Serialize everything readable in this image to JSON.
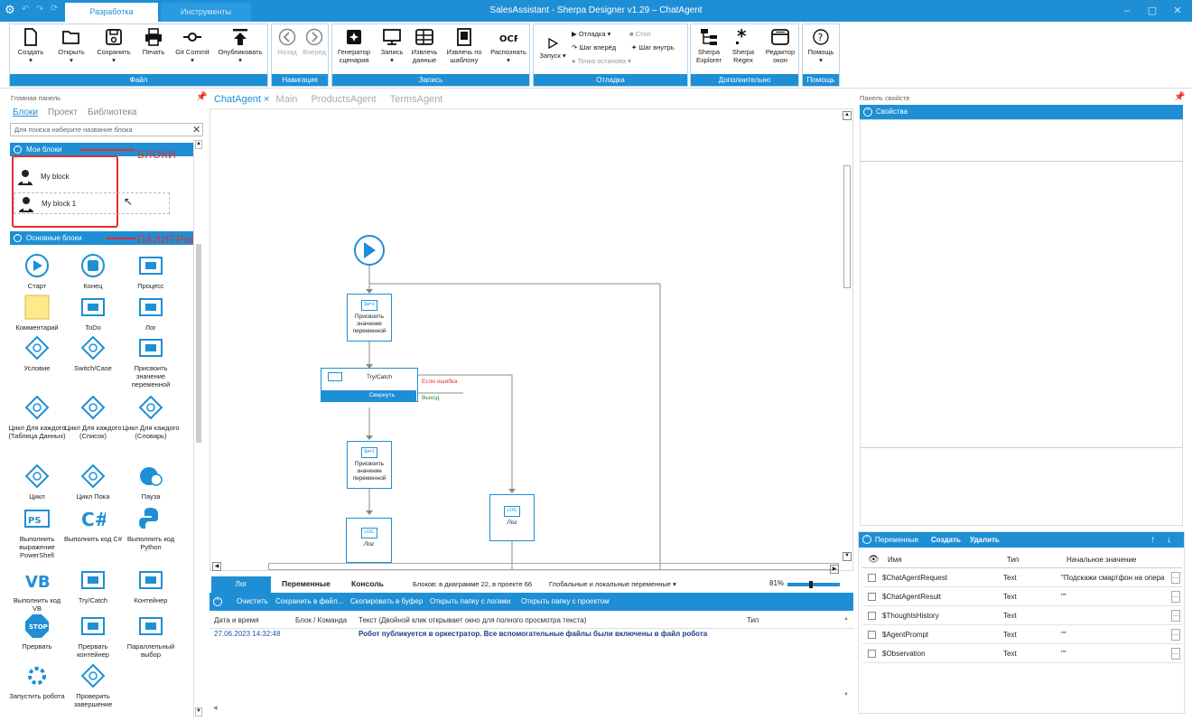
{
  "titlebar": {
    "title": "SalesAssistant - Sherpa Designer v1.29 – ChatAgent",
    "tabs": [
      "Разработка",
      "Инструменты"
    ]
  },
  "ribbon": {
    "file": {
      "label": "Файл",
      "buttons": [
        "Создать",
        "Открыть",
        "Сохранить",
        "Печать",
        "Git Commit",
        "Опубликовать"
      ]
    },
    "navigation": {
      "label": "Навигация",
      "buttons": [
        "Назад",
        "Вперед"
      ]
    },
    "record": {
      "label": "Запись",
      "buttons": [
        "Генератор сценария",
        "Запись",
        "Извлечь данные",
        "Извлечь по шаблону",
        "Распознать"
      ]
    },
    "debug": {
      "label": "Отладка",
      "run": "Запуск",
      "debug": "Отладка",
      "stop": "Стоп",
      "step_forward": "Шаг вперёд",
      "step_into": "Шаг внутрь",
      "breakpoint": "Точка останова"
    },
    "extra": {
      "label": "Дополнительно",
      "buttons": [
        "Sherpa Explorer",
        "Sherpa Regex",
        "Редактор окон"
      ]
    },
    "help": {
      "label": "Помощь",
      "buttons": [
        "Помощь"
      ]
    }
  },
  "left": {
    "panel_title": "Главная панель",
    "tabs": [
      "Блоки",
      "Проект",
      "Библиотека"
    ],
    "search_placeholder": "Для поиска наберите название блока",
    "my_blocks_header": "Мои блоки",
    "my_blocks": [
      "My block",
      "My block 1"
    ],
    "basic_blocks_header": "Основные блоки",
    "annot_blocks": "БЛОКИ",
    "annot_palettes": "ПАЛИТРЫ",
    "palette": [
      "Старт",
      "Конец",
      "Процесс",
      "Комментарий",
      "ToDo",
      "Лог",
      "Условие",
      "Switch/Case",
      "Присвоить значение переменной",
      "Цикл Для каждого (Таблица Данных)",
      "Цикл Для каждого (Список)",
      "Цикл Для каждого (Словарь)",
      "Цикл",
      "Цикл Пока",
      "Пауза",
      "Выполнить выражение PowerShell",
      "Выполнить код C#",
      "Выполнить код Python",
      "Выполнить код VB",
      "Try/Catch",
      "Контейнер",
      "Прервать",
      "Прервать контейнер",
      "Параллельный выбор",
      "Запустить робота",
      "Проверить завершение"
    ]
  },
  "center": {
    "doc_tabs": [
      "ChatAgent",
      "Main",
      "ProductsAgent",
      "TermsAgent"
    ],
    "nodes": {
      "assign1": "Присвоить значение переменной",
      "trycatch": "Try/Catch",
      "collapse": "Свернуть",
      "on_error": "Если ошибка",
      "exit": "Выход",
      "assign2": "Присвоить значение переменной",
      "log1": "Лог",
      "log2": "Лог"
    }
  },
  "log": {
    "tabs": [
      "Лог",
      "Переменные",
      "Консоль"
    ],
    "blocks_info": "Блоков: в диаграмме 22, в проекте 66",
    "scope": "Глобальные и локальные переменные",
    "zoom": "81%",
    "actions": [
      "Очистить",
      "Сохранить в файл...",
      "Скопировать в буфер",
      "Открыть папку с логами",
      "Открыть папку с проектом"
    ],
    "columns": [
      "Дата и время",
      "Блок / Команда",
      "Текст (Двойной клик открывает окно для полного просмотра текста)",
      "Тип"
    ],
    "rows": [
      {
        "time": "27.06.2023 14:32:48",
        "block": "",
        "text": "Робот публикуется в оркестратор. Все вспомогательные файлы были включены в файл робота",
        "type": ""
      }
    ]
  },
  "props": {
    "title": "Панель свойств",
    "header": "Свойства"
  },
  "vars": {
    "header": "Переменные",
    "create": "Создать",
    "delete": "Удалить",
    "columns": [
      "Имя",
      "Тип",
      "Начальное значение"
    ],
    "rows": [
      {
        "name": "$ChatAgentRequest",
        "type": "Text",
        "value": "\"Подскажи смартфон на опера"
      },
      {
        "name": "$ChatAgentResult",
        "type": "Text",
        "value": "\"\""
      },
      {
        "name": "$ThoughtsHistory",
        "type": "Text",
        "value": ""
      },
      {
        "name": "$AgentPrompt",
        "type": "Text",
        "value": "\"\""
      },
      {
        "name": "$Observation",
        "type": "Text",
        "value": "\"\""
      }
    ]
  },
  "colors": {
    "accent": "#1e8fd5",
    "annotation": "#e03030"
  }
}
